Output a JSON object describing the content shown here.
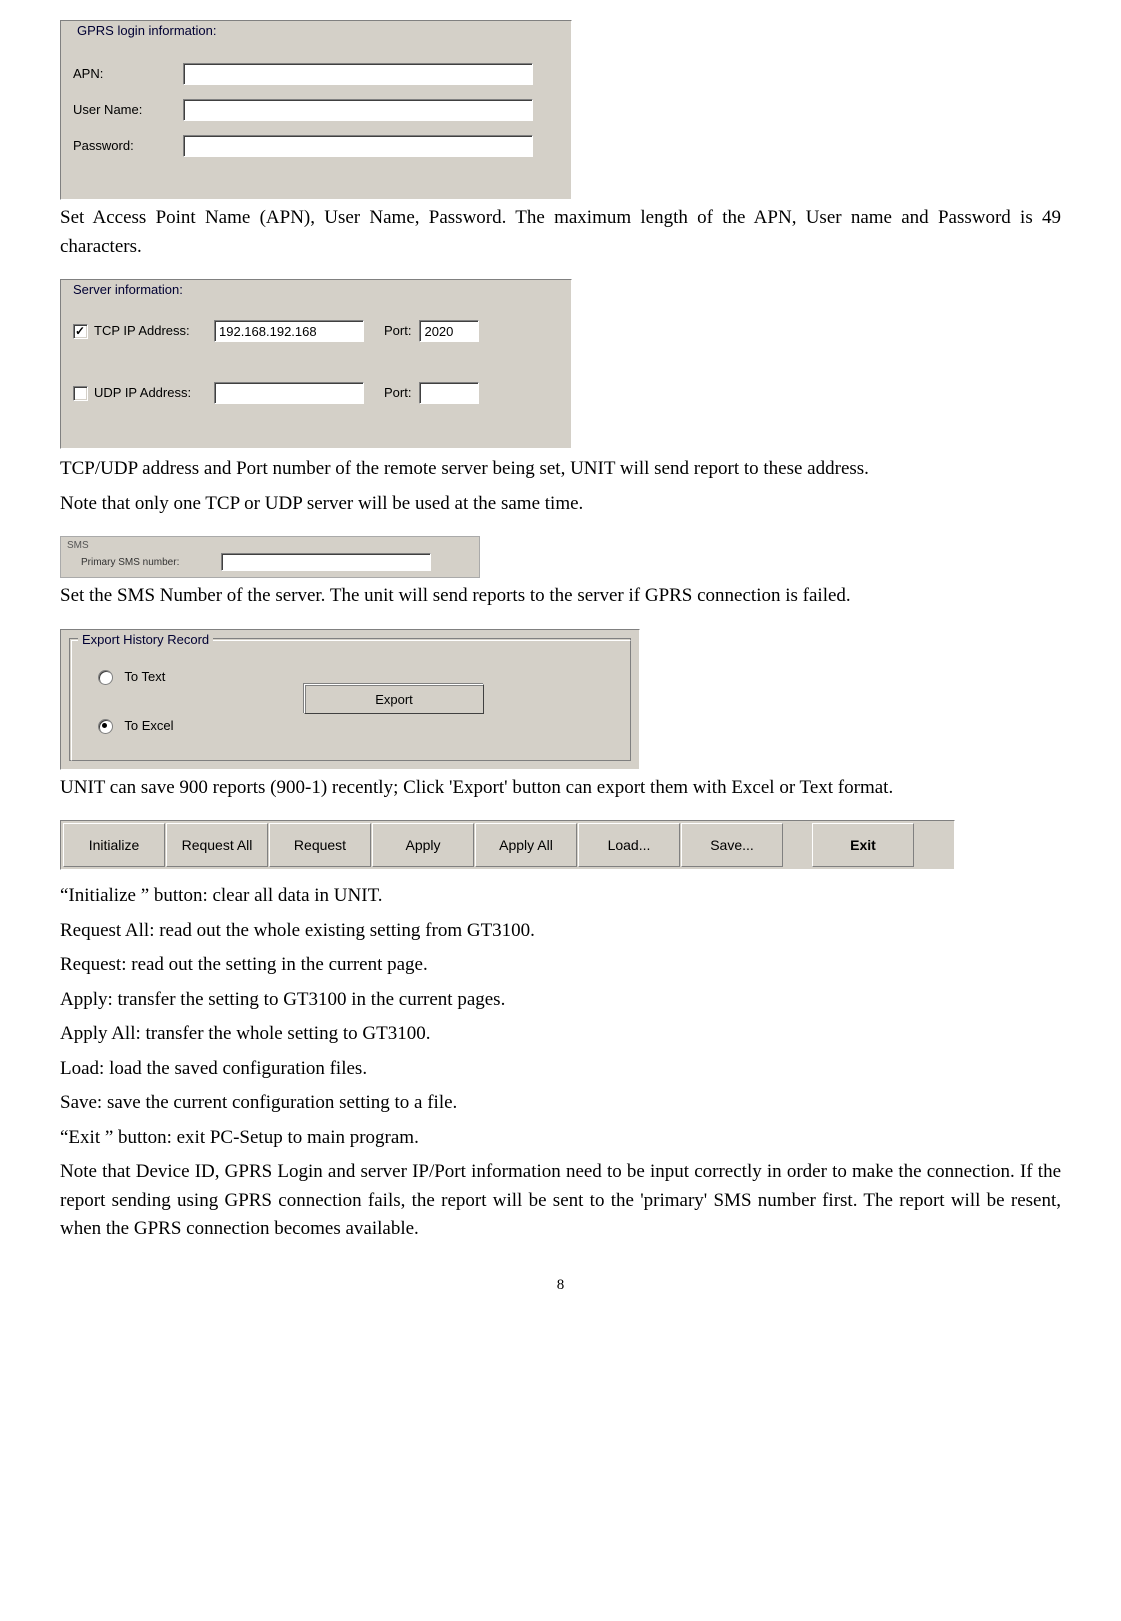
{
  "gprs": {
    "legend": "GPRS login information:",
    "apn_label": "APN:",
    "apn_value": "",
    "user_label": "User Name:",
    "user_value": "",
    "pass_label": "Password:",
    "pass_value": ""
  },
  "text_gprs": "Set Access Point Name (APN), User Name, Password. The maximum length of the APN, User name and Password is 49 characters.",
  "server": {
    "legend": "Server information:",
    "tcp_label": "TCP IP Address:",
    "tcp_checked": true,
    "tcp_ip": "192.168.192.168",
    "tcp_port_label": "Port:",
    "tcp_port": "2020",
    "udp_label": "UDP IP Address:",
    "udp_checked": false,
    "udp_ip": "",
    "udp_port_label": "Port:",
    "udp_port": ""
  },
  "text_server1": "TCP/UDP address and Port number of the remote server being set, UNIT will send report to these address.",
  "text_server2": "Note that only one TCP or UDP server will be used at the same time.",
  "sms": {
    "legend": "SMS",
    "label": "Primary SMS number:",
    "value": ""
  },
  "text_sms": "Set the SMS Number of the server. The unit will send reports to the server if GPRS connection is failed.",
  "export": {
    "legend": "Export History Record",
    "to_text_label": "To Text",
    "to_excel_label": "To Excel",
    "selected": "excel",
    "button": "Export"
  },
  "text_export": "UNIT can save 900 reports (900-1) recently; Click 'Export' button can export them with Excel or Text format.",
  "toolbar": {
    "initialize": "Initialize",
    "request_all": "Request All",
    "request": "Request",
    "apply": "Apply",
    "apply_all": "Apply All",
    "load": "Load...",
    "save": "Save...",
    "exit": "Exit"
  },
  "descriptions": [
    "“Initialize ” button: clear all data in UNIT.",
    "Request All: read out the whole existing setting from GT3100.",
    "Request: read out the setting in the current page.",
    "Apply: transfer the setting to GT3100 in the current pages.",
    "Apply All: transfer the whole setting to GT3100.",
    "Load: load the saved configuration files.",
    "Save: save the current configuration setting to a file.",
    "“Exit ” button: exit PC-Setup to main program."
  ],
  "text_note": "Note that Device ID, GPRS Login and server IP/Port information need to be input correctly in order to make the connection. If the report sending using GPRS connection fails, the report will be sent to the 'primary' SMS number first. The report will be resent, when the GPRS connection becomes available.",
  "page_number": "8"
}
